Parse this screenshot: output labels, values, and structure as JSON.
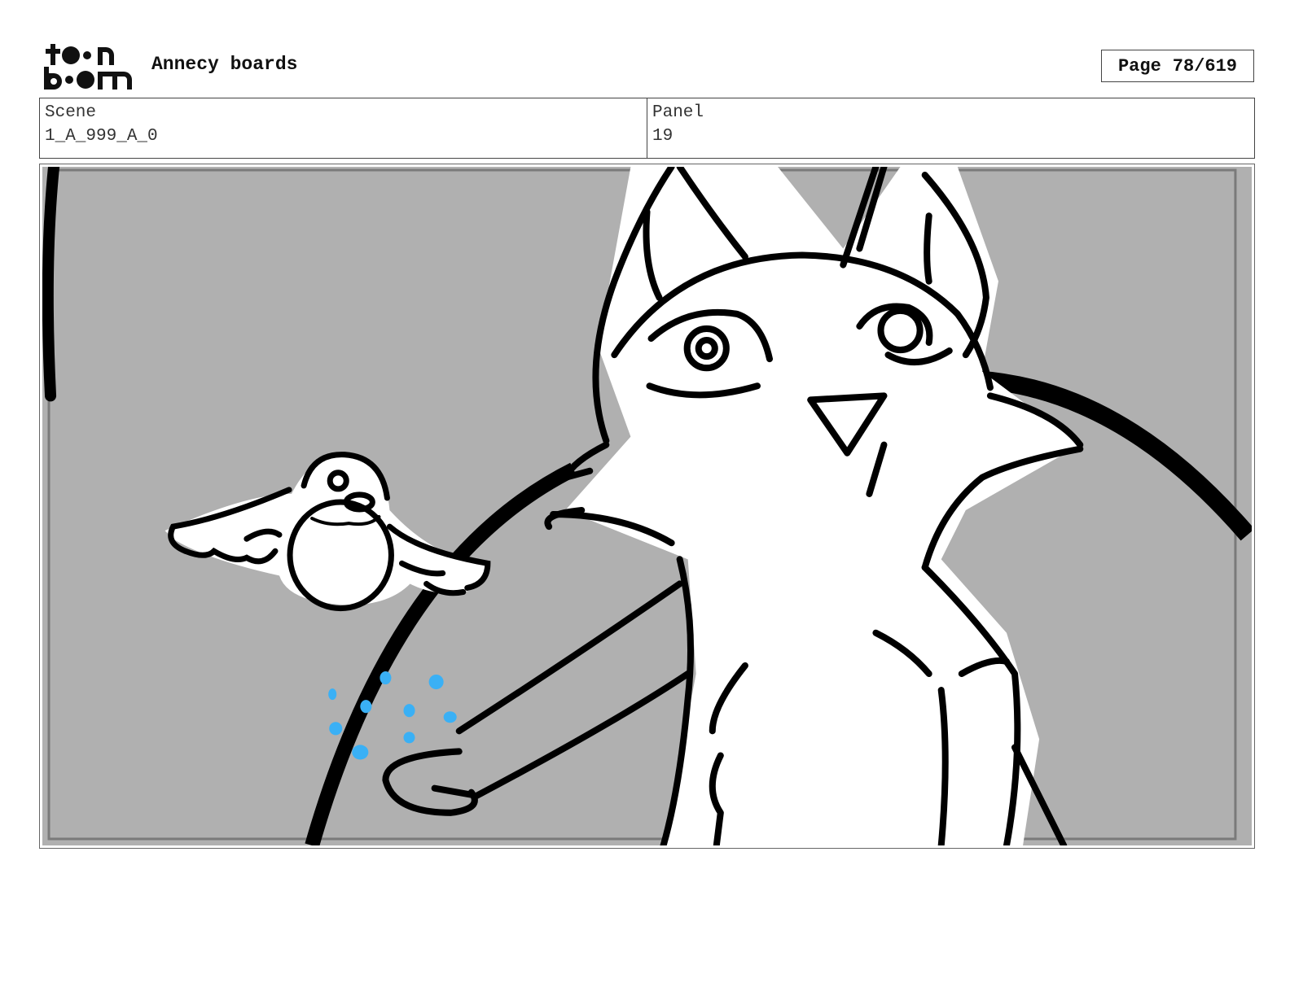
{
  "header": {
    "logo_text": "toonboom",
    "project_title": "Annecy boards",
    "page_label": "Page",
    "page_value": "78/619"
  },
  "meta": {
    "scene_label": "Scene",
    "scene_value": "1_A_999_A_0",
    "panel_label": "Panel",
    "panel_value": "19"
  },
  "panel_image": {
    "background_color": "#b0b0b0",
    "ink_color": "#000000",
    "accent_color": "#3ab0f5"
  }
}
